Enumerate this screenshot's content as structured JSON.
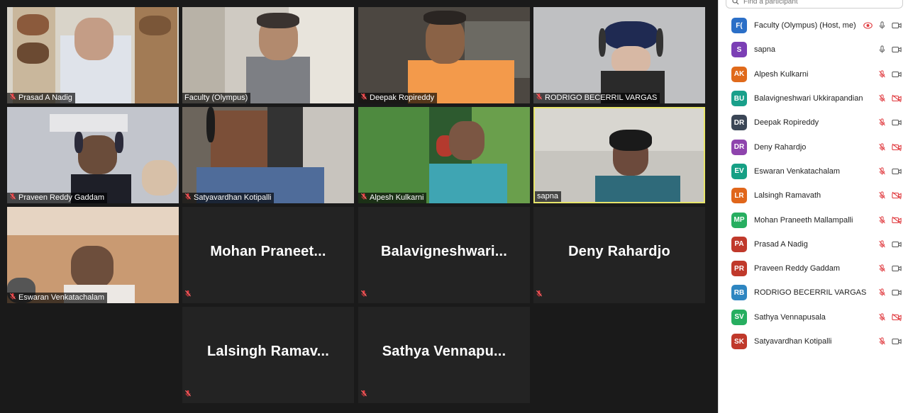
{
  "gallery": {
    "tiles": [
      {
        "id": "prasad",
        "kind": "video",
        "name": "Prasad A Nadig",
        "muted": true,
        "active": false
      },
      {
        "id": "faculty",
        "kind": "video",
        "name": "Faculty (Olympus)",
        "muted": false,
        "active": false
      },
      {
        "id": "deepak",
        "kind": "video",
        "name": "Deepak Ropireddy",
        "muted": true,
        "active": false
      },
      {
        "id": "rodrigo",
        "kind": "video",
        "name": "RODRIGO BECERRIL VARGAS",
        "muted": true,
        "active": false
      },
      {
        "id": "praveen",
        "kind": "video",
        "name": "Praveen Reddy Gaddam",
        "muted": true,
        "active": false
      },
      {
        "id": "satya",
        "kind": "video",
        "name": "Satyavardhan Kotipalli",
        "muted": true,
        "active": false
      },
      {
        "id": "alpesh",
        "kind": "video",
        "name": "Alpesh Kulkarni",
        "muted": true,
        "active": false
      },
      {
        "id": "sapna",
        "kind": "video",
        "name": "sapna",
        "muted": false,
        "active": true
      },
      {
        "id": "eswaran",
        "kind": "video",
        "name": "Eswaran Venkatachalam",
        "muted": true,
        "active": false
      },
      {
        "id": "mohan",
        "kind": "name",
        "name": "Mohan  Praneet...",
        "muted": true,
        "active": false
      },
      {
        "id": "bala",
        "kind": "name",
        "name": "Balavigneshwari...",
        "muted": true,
        "active": false
      },
      {
        "id": "deny",
        "kind": "name",
        "name": "Deny Rahardjo",
        "muted": true,
        "active": false
      },
      {
        "id": "lalsingh",
        "kind": "name",
        "name": "Lalsingh  Ramav...",
        "muted": true,
        "active": false
      },
      {
        "id": "sathya",
        "kind": "name",
        "name": "Sathya  Vennapu...",
        "muted": true,
        "active": false
      }
    ]
  },
  "participants_panel": {
    "search_placeholder": "Find a participant",
    "participants": [
      {
        "initials": "F(",
        "name": "Faculty (Olympus) (Host, me)",
        "color": "#2b6fc7",
        "mic": "on",
        "video": "on",
        "recording": true
      },
      {
        "initials": "S",
        "name": "sapna",
        "color": "#7b3fb5",
        "mic": "on",
        "video": "on",
        "recording": false
      },
      {
        "initials": "AK",
        "name": "Alpesh Kulkarni",
        "color": "#e06a1b",
        "mic": "muted",
        "video": "on",
        "recording": false
      },
      {
        "initials": "BU",
        "name": "Balavigneshwari Ukkirapandian",
        "color": "#19a08a",
        "mic": "muted",
        "video": "off",
        "recording": false
      },
      {
        "initials": "DR",
        "name": "Deepak Ropireddy",
        "color": "#3b4656",
        "mic": "muted",
        "video": "on",
        "recording": false
      },
      {
        "initials": "DR",
        "name": "Deny Rahardjo",
        "color": "#8e44ad",
        "mic": "muted",
        "video": "off",
        "recording": false
      },
      {
        "initials": "EV",
        "name": "Eswaran Venkatachalam",
        "color": "#16a085",
        "mic": "muted",
        "video": "on",
        "recording": false
      },
      {
        "initials": "LR",
        "name": "Lalsingh Ramavath",
        "color": "#e0661b",
        "mic": "muted",
        "video": "off",
        "recording": false
      },
      {
        "initials": "MP",
        "name": "Mohan Praneeth Mallampalli",
        "color": "#27ae60",
        "mic": "muted",
        "video": "off",
        "recording": false
      },
      {
        "initials": "PA",
        "name": "Prasad A Nadig",
        "color": "#c0392b",
        "mic": "muted",
        "video": "on",
        "recording": false
      },
      {
        "initials": "PR",
        "name": "Praveen Reddy Gaddam",
        "color": "#c0392b",
        "mic": "muted",
        "video": "on",
        "recording": false
      },
      {
        "initials": "RB",
        "name": "RODRIGO BECERRIL VARGAS",
        "color": "#2e86c1",
        "mic": "muted",
        "video": "on",
        "recording": false
      },
      {
        "initials": "SV",
        "name": "Sathya Vennapusala",
        "color": "#27ae60",
        "mic": "muted",
        "video": "off",
        "recording": false
      },
      {
        "initials": "SK",
        "name": "Satyavardhan Kotipalli",
        "color": "#c0392b",
        "mic": "muted",
        "video": "on",
        "recording": false
      }
    ]
  },
  "colors": {
    "active_speaker_border": "#e7e56a",
    "muted_red": "#e0393e",
    "gallery_bg": "#1a1a1a",
    "tile_bg": "#232323"
  }
}
